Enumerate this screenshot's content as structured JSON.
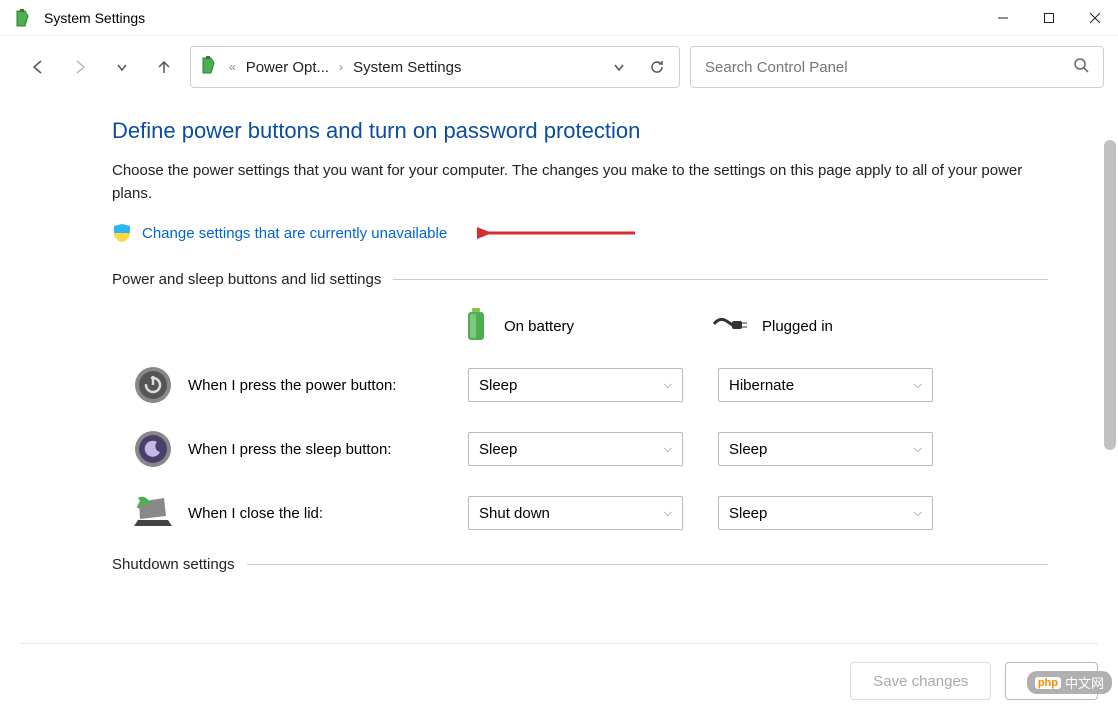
{
  "window": {
    "title": "System Settings"
  },
  "toolbar": {
    "breadcrumb": {
      "parent": "Power Opt...",
      "current": "System Settings"
    },
    "search_placeholder": "Search Control Panel"
  },
  "content": {
    "heading": "Define power buttons and turn on password protection",
    "description": "Choose the power settings that you want for your computer. The changes you make to the settings on this page apply to all of your power plans.",
    "change_link": "Change settings that are currently unavailable",
    "section1_title": "Power and sleep buttons and lid settings",
    "columns": {
      "battery": "On battery",
      "plugged": "Plugged in"
    },
    "rows": [
      {
        "label": "When I press the power button:",
        "battery": "Sleep",
        "plugged": "Hibernate"
      },
      {
        "label": "When I press the sleep button:",
        "battery": "Sleep",
        "plugged": "Sleep"
      },
      {
        "label": "When I close the lid:",
        "battery": "Shut down",
        "plugged": "Sleep"
      }
    ],
    "section2_title": "Shutdown settings"
  },
  "footer": {
    "save": "Save changes",
    "cancel": "Cancel"
  },
  "watermark": {
    "brand": "php",
    "text": "中文网"
  }
}
